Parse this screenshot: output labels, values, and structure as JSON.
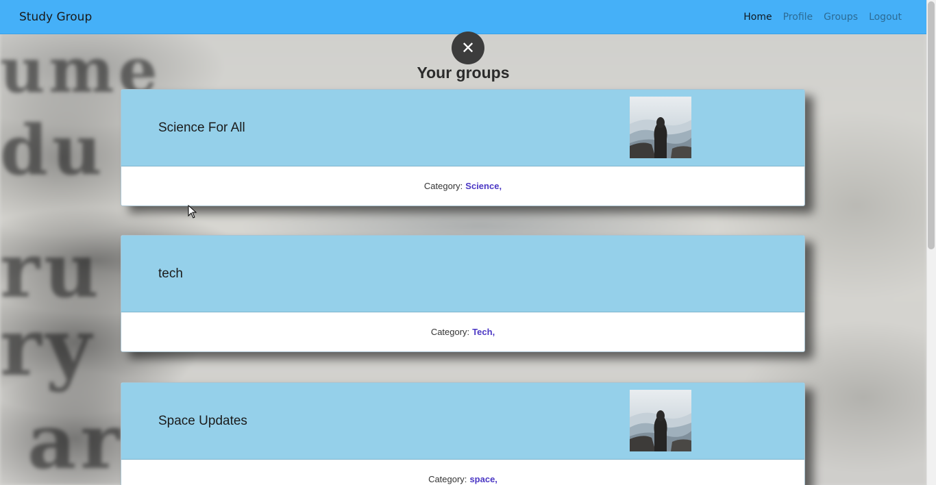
{
  "navbar": {
    "brand": "Study Group",
    "links": [
      {
        "label": "Home",
        "active": true
      },
      {
        "label": "Profile",
        "active": false
      },
      {
        "label": "Groups",
        "active": false
      },
      {
        "label": "Logout",
        "active": false
      }
    ],
    "background_color": "#45b0f8"
  },
  "close_button": {
    "glyph": "✕",
    "icon": "close-icon"
  },
  "page": {
    "title": "Your groups"
  },
  "groups": [
    {
      "name": "Science For All",
      "has_image": true,
      "category_label": "Category:",
      "category": "Science,"
    },
    {
      "name": "tech",
      "has_image": false,
      "category_label": "Category:",
      "category": "Tech,"
    },
    {
      "name": "Space Updates",
      "has_image": true,
      "category_label": "Category:",
      "category": "space,"
    }
  ],
  "colors": {
    "card_header": "#95d0ea",
    "category_link": "#4b37c4"
  }
}
